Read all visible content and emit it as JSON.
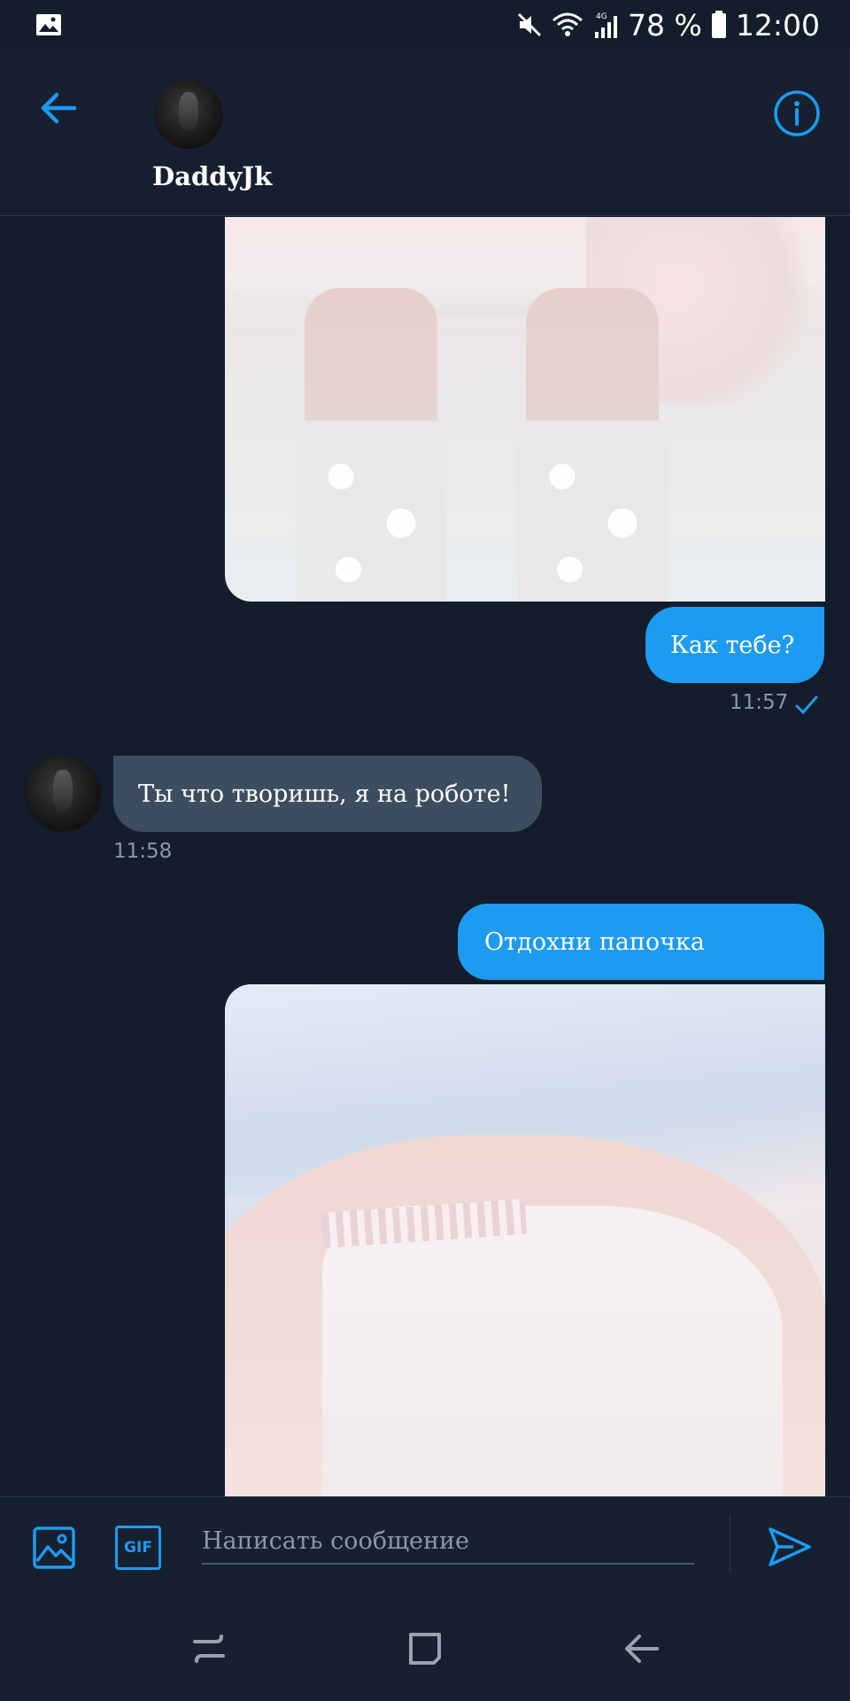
{
  "status_bar": {
    "battery_percent": "78 %",
    "time": "12:00",
    "network_label": "4G",
    "icons": [
      "gallery-icon",
      "mute-icon",
      "wifi-icon",
      "signal-icon",
      "battery-icon"
    ]
  },
  "header": {
    "contact_name": "DaddyJk",
    "icons": [
      "back-arrow-icon",
      "info-icon"
    ]
  },
  "messages": [
    {
      "direction": "out",
      "type": "image",
      "icon": "photo-stockings"
    },
    {
      "direction": "out",
      "type": "text",
      "text": "Как тебе?",
      "time": "11:57",
      "status_icon": "check-icon"
    },
    {
      "direction": "in",
      "type": "text",
      "text": "Ты что творишь, я на роботе!",
      "time": "11:58"
    },
    {
      "direction": "out",
      "type": "text",
      "text": "Отдохни папочка"
    },
    {
      "direction": "out",
      "type": "image",
      "icon": "photo-lingerie"
    }
  ],
  "composer": {
    "placeholder": "Написать сообщение",
    "gif_label": "GIF",
    "icons": [
      "image-icon",
      "gif-icon",
      "send-icon"
    ]
  },
  "colors": {
    "background": "#141d2b",
    "bar": "#172031",
    "accent": "#1d9bf0",
    "incoming_bubble": "#3d4d60",
    "muted_text": "#8b98a5"
  }
}
